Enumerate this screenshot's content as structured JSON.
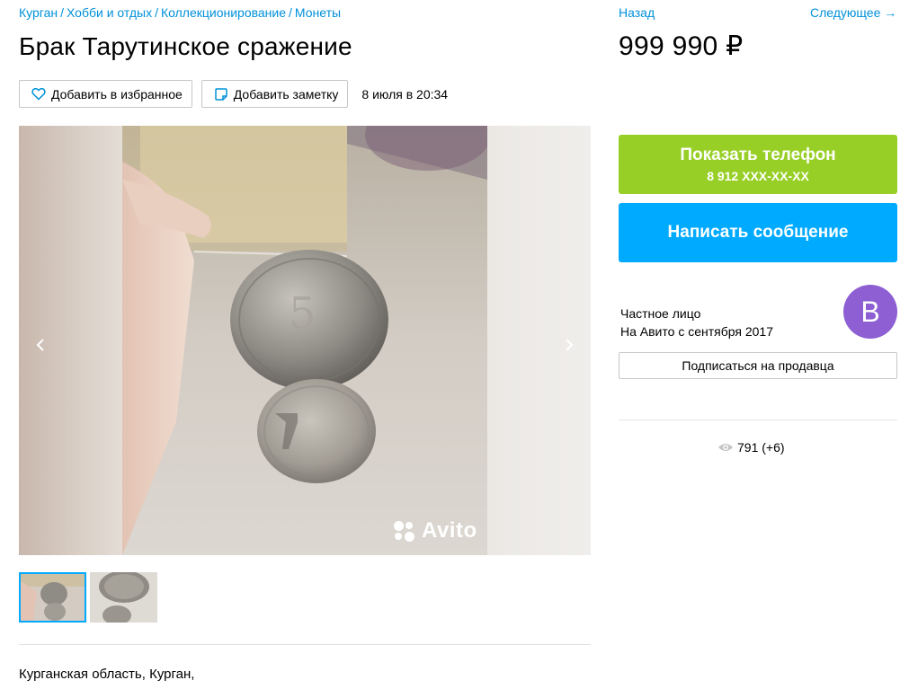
{
  "breadcrumbs": [
    "Курган",
    "Хобби и отдых",
    "Коллекционирование",
    "Монеты"
  ],
  "title": "Брак Тарутинское сражение",
  "actions": {
    "favorite_label": "Добавить в избранное",
    "note_label": "Добавить заметку",
    "date": "8 июля в 20:34"
  },
  "gallery": {
    "watermark": "Avito",
    "thumbnails_count": 2
  },
  "address": "Курганская область, Курган,",
  "nav": {
    "back_label": "Назад",
    "next_label": "Следующее →"
  },
  "price": "999 990 ₽",
  "contact": {
    "phone_button_label": "Показать телефон",
    "phone_masked": "8 912 XXX-XX-XX",
    "message_button_label": "Написать сообщение"
  },
  "seller": {
    "type": "Частное лицо",
    "since": "На Авито с сентября 2017",
    "avatar_letter": "B",
    "avatar_color": "#8d5fd3",
    "subscribe_label": "Подписаться на продавца"
  },
  "stats": {
    "views": "791 (+6)"
  },
  "colors": {
    "link": "#0091d9",
    "phone_button": "#97cf26",
    "message_button": "#00aaff"
  }
}
